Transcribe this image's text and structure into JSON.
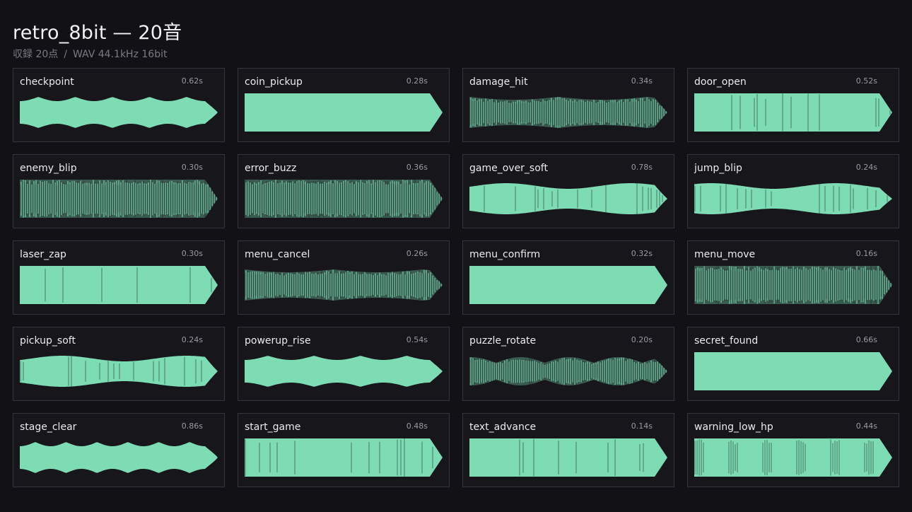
{
  "header": {
    "title": "retro_8bit — 20音",
    "count": "収録 20点",
    "separator": "/",
    "format": "WAV 44.1kHz 16bit"
  },
  "colors": {
    "waveform": "#7ddcb4",
    "background": "#121216",
    "card_border": "#34343a"
  },
  "sounds": [
    {
      "name": "checkpoint",
      "duration": "0.62s",
      "style": "lobes",
      "n": 5
    },
    {
      "name": "coin_pickup",
      "duration": "0.28s",
      "style": "solid"
    },
    {
      "name": "damage_hit",
      "duration": "0.34s",
      "style": "sparse"
    },
    {
      "name": "door_open",
      "duration": "0.52s",
      "style": "mixed"
    },
    {
      "name": "enemy_blip",
      "duration": "0.30s",
      "style": "striped"
    },
    {
      "name": "error_buzz",
      "duration": "0.36s",
      "style": "striped"
    },
    {
      "name": "game_over_soft",
      "duration": "0.78s",
      "style": "wavy"
    },
    {
      "name": "jump_blip",
      "duration": "0.24s",
      "style": "wavy"
    },
    {
      "name": "laser_zap",
      "duration": "0.30s",
      "style": "solid_lines"
    },
    {
      "name": "menu_cancel",
      "duration": "0.26s",
      "style": "sparse"
    },
    {
      "name": "menu_confirm",
      "duration": "0.32s",
      "style": "solid"
    },
    {
      "name": "menu_move",
      "duration": "0.16s",
      "style": "striped"
    },
    {
      "name": "pickup_soft",
      "duration": "0.24s",
      "style": "wavy"
    },
    {
      "name": "powerup_rise",
      "duration": "0.54s",
      "style": "lobes",
      "n": 4
    },
    {
      "name": "puzzle_rotate",
      "duration": "0.20s",
      "style": "puzzle"
    },
    {
      "name": "secret_found",
      "duration": "0.66s",
      "style": "solid"
    },
    {
      "name": "stage_clear",
      "duration": "0.86s",
      "style": "lobes",
      "n": 6
    },
    {
      "name": "start_game",
      "duration": "0.48s",
      "style": "solid_lines"
    },
    {
      "name": "text_advance",
      "duration": "0.14s",
      "style": "solid_lines"
    },
    {
      "name": "warning_low_hp",
      "duration": "0.44s",
      "style": "warning"
    }
  ]
}
